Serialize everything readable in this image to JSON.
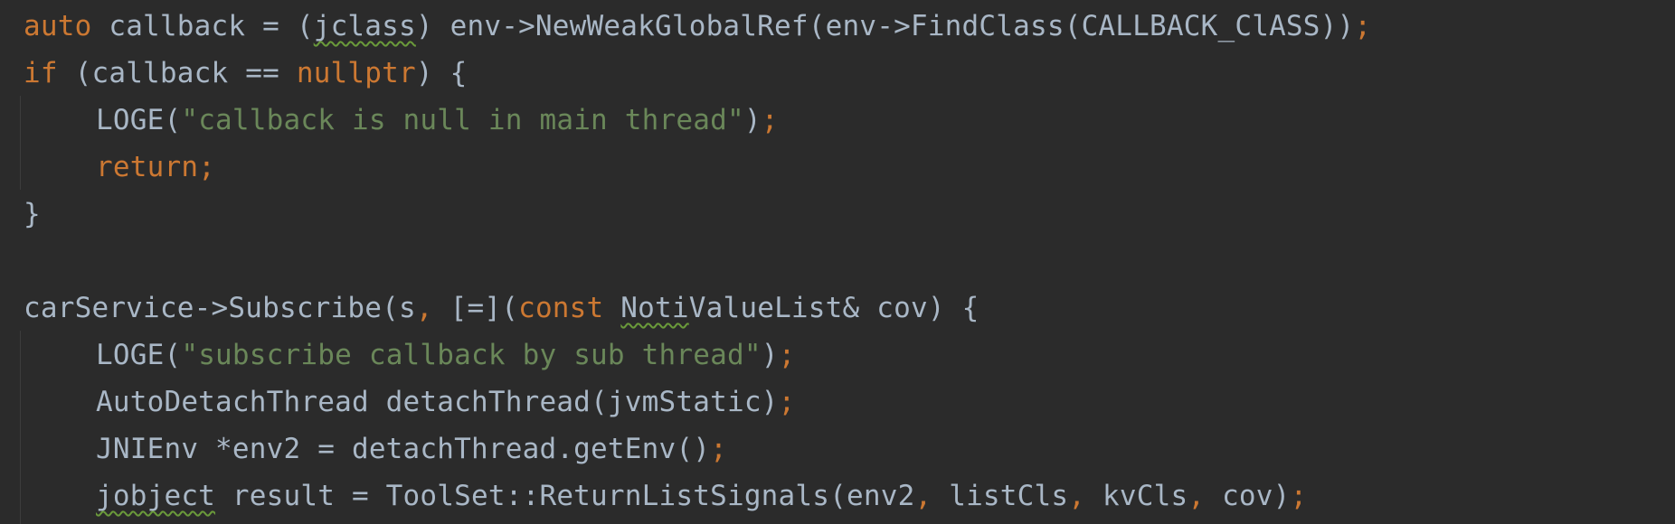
{
  "editor": {
    "lines": [
      {
        "tokens": [
          {
            "t": "auto",
            "c": "kw"
          },
          {
            "t": " callback = (",
            "c": "fn"
          },
          {
            "t": "jclass",
            "c": "warn"
          },
          {
            "t": ") env->NewWeakGlobalRef(env->FindClass(CALLBACK_ClASS))",
            "c": "fn"
          },
          {
            "t": ";",
            "c": "pn"
          }
        ]
      },
      {
        "tokens": [
          {
            "t": "if",
            "c": "kw"
          },
          {
            "t": " (callback == ",
            "c": "fn"
          },
          {
            "t": "nullptr",
            "c": "kw"
          },
          {
            "t": ") {",
            "c": "fn"
          }
        ]
      },
      {
        "indent": 1,
        "tokens": [
          {
            "t": "LOGE(",
            "c": "fn"
          },
          {
            "t": "\"callback is null in main thread\"",
            "c": "str"
          },
          {
            "t": ")",
            "c": "fn"
          },
          {
            "t": ";",
            "c": "pn"
          }
        ]
      },
      {
        "indent": 1,
        "tokens": [
          {
            "t": "return;",
            "c": "kw"
          }
        ]
      },
      {
        "tokens": [
          {
            "t": "}",
            "c": "fn"
          }
        ]
      },
      {
        "tokens": []
      },
      {
        "tokens": [
          {
            "t": "carService->Subscribe(s",
            "c": "fn"
          },
          {
            "t": ",",
            "c": "pn"
          },
          {
            "t": " [=](",
            "c": "fn"
          },
          {
            "t": "const",
            "c": "kw"
          },
          {
            "t": " ",
            "c": "fn"
          },
          {
            "t": "Noti",
            "c": "warn"
          },
          {
            "t": "ValueList& cov) {",
            "c": "fn"
          }
        ]
      },
      {
        "indent": 1,
        "tokens": [
          {
            "t": "LOGE(",
            "c": "fn"
          },
          {
            "t": "\"subscribe callback by sub thread\"",
            "c": "str"
          },
          {
            "t": ")",
            "c": "fn"
          },
          {
            "t": ";",
            "c": "pn"
          }
        ]
      },
      {
        "indent": 1,
        "tokens": [
          {
            "t": "AutoDetachThread detachThread(jvmStatic)",
            "c": "fn"
          },
          {
            "t": ";",
            "c": "pn"
          }
        ]
      },
      {
        "indent": 1,
        "tokens": [
          {
            "t": "JNIEnv *env2 = detachThread.getEnv()",
            "c": "fn"
          },
          {
            "t": ";",
            "c": "pn"
          }
        ]
      },
      {
        "indent": 1,
        "tokens": [
          {
            "t": "jobject",
            "c": "warn"
          },
          {
            "t": " result = ToolSet::ReturnListSignals(env2",
            "c": "fn"
          },
          {
            "t": ",",
            "c": "pn"
          },
          {
            "t": " listCls",
            "c": "fn"
          },
          {
            "t": ",",
            "c": "pn"
          },
          {
            "t": " kvCls",
            "c": "fn"
          },
          {
            "t": ",",
            "c": "pn"
          },
          {
            "t": " cov)",
            "c": "fn"
          },
          {
            "t": ";",
            "c": "pn"
          }
        ]
      }
    ]
  }
}
